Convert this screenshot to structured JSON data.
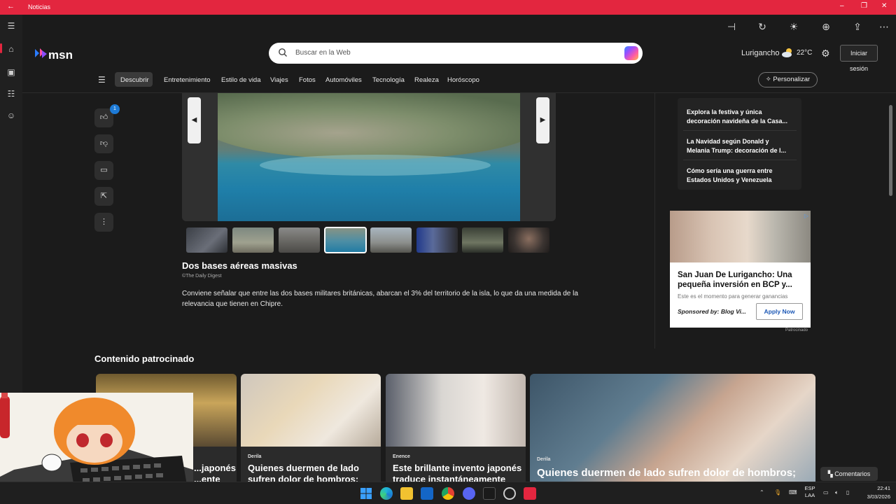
{
  "window": {
    "title": "Noticias",
    "accent": "#e3263f"
  },
  "header": {
    "logo": "msn",
    "search_placeholder": "Buscar en la Web",
    "weather_location": "Lurigancho",
    "weather_temp": "22°C",
    "signin_label": "Iniciar sesión"
  },
  "nav": {
    "items": [
      "Descubrir",
      "Entretenimiento",
      "Estilo de vida",
      "Viajes",
      "Fotos",
      "Automóviles",
      "Tecnología",
      "Realeza",
      "Horóscopo"
    ],
    "active": "Descubrir",
    "personalize_label": "Personalizar"
  },
  "actions": {
    "like_count": "1"
  },
  "slideshow": {
    "title": "Dos bases aéreas masivas",
    "source": "©The Daily Digest",
    "body": "Conviene señalar que entre las dos bases militares británicas, abarcan el 3% del territorio de la isla, lo que da una medida de la relevancia que tienen en Chipre.",
    "selected_thumb": 4
  },
  "related": [
    "Explora la festiva y única decoración navideña de la Casa...",
    "La Navidad según Donald y Melania Trump: decoración de l...",
    "Cómo sería una guerra entre Estados Unidos y Venezuela"
  ],
  "ad": {
    "headline": "San Juan De Lurigancho: Una pequeña inversión en BCP y...",
    "sub": "Este es el momento para generar ganancias",
    "sponsor": "Sponsored by: Blog Vi...",
    "cta": "Apply Now",
    "label": "Patrocinado"
  },
  "sponsored": {
    "title": "Contenido patrocinado",
    "cards": [
      {
        "tag": "",
        "headline": "...japonés ...ente"
      },
      {
        "tag": "Derila",
        "headline": "Quienes duermen de lado sufren dolor de hombros;"
      },
      {
        "tag": "Enence",
        "headline": "Este brillante invento japonés traduce instantáneamente"
      },
      {
        "tag": "Derila",
        "headline": "Quienes duermen de lado sufren dolor de hombros;"
      }
    ]
  },
  "comments_label": "Comentarios",
  "taskbar": {
    "lang_top": "ESP",
    "lang_bottom": "LAA",
    "time": "22:41",
    "date": "3/03/2026"
  }
}
